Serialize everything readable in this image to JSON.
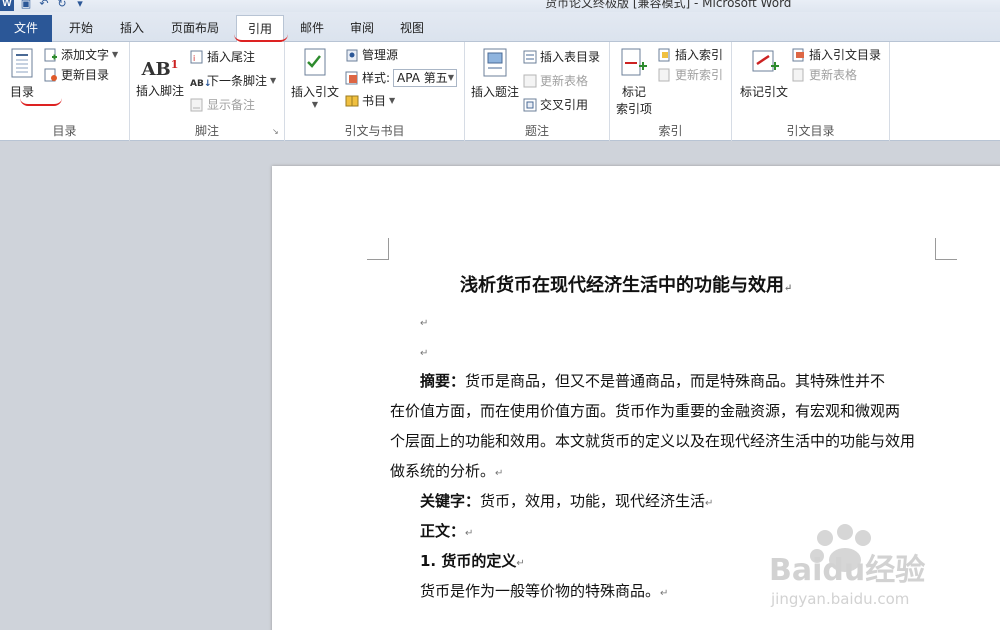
{
  "window": {
    "title": "货币论文终极版 [兼容模式] - Microsoft Word"
  },
  "quick_access": {
    "logo": "W"
  },
  "tabs": [
    {
      "label": "文件"
    },
    {
      "label": "开始"
    },
    {
      "label": "插入"
    },
    {
      "label": "页面布局"
    },
    {
      "label": "引用"
    },
    {
      "label": "邮件"
    },
    {
      "label": "审阅"
    },
    {
      "label": "视图"
    }
  ],
  "ribbon": {
    "toc": {
      "big": "目录",
      "add_text": "添加文字",
      "update": "更新目录",
      "label": "目录"
    },
    "footnotes": {
      "insert_footnote": "插入脚注",
      "insert_endnote": "插入尾注",
      "next_footnote": "下一条脚注",
      "show_notes": "显示备注",
      "label": "脚注"
    },
    "citations": {
      "insert_citation": "插入引文",
      "manage_sources": "管理源",
      "style_label": "样式:",
      "style_value": "APA 第五",
      "bibliography": "书目",
      "label": "引文与书目"
    },
    "captions": {
      "insert_caption": "插入题注",
      "insert_table_figures": "插入表目录",
      "update_table": "更新表格",
      "cross_reference": "交叉引用",
      "label": "题注"
    },
    "index": {
      "mark_entry": "标记\n索引项",
      "mark_entry_1": "标记",
      "mark_entry_2": "索引项",
      "insert_index": "插入索引",
      "update_index": "更新索引",
      "label": "索引"
    },
    "authorities": {
      "mark_citation": "标记引文",
      "insert_toa": "插入引文目录",
      "update_table": "更新表格",
      "label": "引文目录"
    }
  },
  "document": {
    "title": "浅析货币在现代经济生活中的功能与效用",
    "para_mark": "↵",
    "abstract_label": "摘要：",
    "abstract_line1": "货币是商品，但又不是普通商品，而是特殊商品。其特殊性并不",
    "abstract_line2": "在价值方面，而在使用价值方面。货币作为重要的金融资源，有宏观和微观两",
    "abstract_line3": "个层面上的功能和效用。本文就货币的定义以及在现代经济生活中的功能与效用",
    "abstract_line4": "做系统的分析。",
    "keywords_label": "关键字：",
    "keywords": "货币，效用，功能，现代经济生活",
    "body_label": "正文：",
    "section1": "1. 货币的定义",
    "section1_text": "货币是作为一般等价物的特殊商品。"
  },
  "watermark": {
    "brand": "Baidu经验",
    "url": "jingyan.baidu.com"
  },
  "colors": {
    "file_tab": "#2b5797",
    "annotation": "#dd2222",
    "ribbon_bg": "#ffffff"
  }
}
